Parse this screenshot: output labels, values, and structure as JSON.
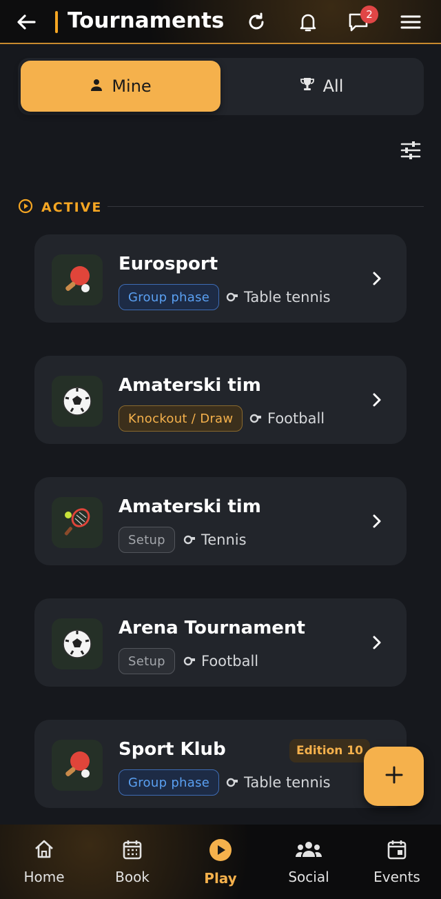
{
  "header": {
    "title": "Tournaments",
    "notification_count": "2"
  },
  "tabs": {
    "mine_label": "Mine",
    "all_label": "All",
    "active": "mine"
  },
  "section": {
    "label": "ACTIVE"
  },
  "tournaments": [
    {
      "title": "Eurosport",
      "status": "Group phase",
      "sport": "Table tennis",
      "sport_icon": "ping-pong"
    },
    {
      "title": "Amaterski tim",
      "status": "Knockout / Draw",
      "sport": "Football",
      "sport_icon": "soccer-ball"
    },
    {
      "title": "Amaterski tim",
      "status": "Setup",
      "sport": "Tennis",
      "sport_icon": "tennis-racket"
    },
    {
      "title": "Arena Tournament",
      "status": "Setup",
      "sport": "Football",
      "sport_icon": "soccer-ball"
    },
    {
      "title": "Sport Klub",
      "status": "Group phase",
      "sport": "Table tennis",
      "sport_icon": "ping-pong",
      "badge": "Edition 10"
    }
  ],
  "fab": {
    "icon": "plus-icon"
  },
  "bottom_nav": [
    {
      "label": "Home",
      "icon": "home-icon"
    },
    {
      "label": "Book",
      "icon": "calendar-grid-icon"
    },
    {
      "label": "Play",
      "icon": "play-icon",
      "active": true
    },
    {
      "label": "Social",
      "icon": "people-icon"
    },
    {
      "label": "Events",
      "icon": "event-calendar-icon"
    }
  ],
  "colors": {
    "accent": "#f5b14c",
    "background": "#16181d",
    "card": "#22252b",
    "group_phase": "#5aa0f2",
    "knockout": "#f5b14c",
    "setup": "#a3a6ab",
    "badge_red": "#e04646"
  }
}
